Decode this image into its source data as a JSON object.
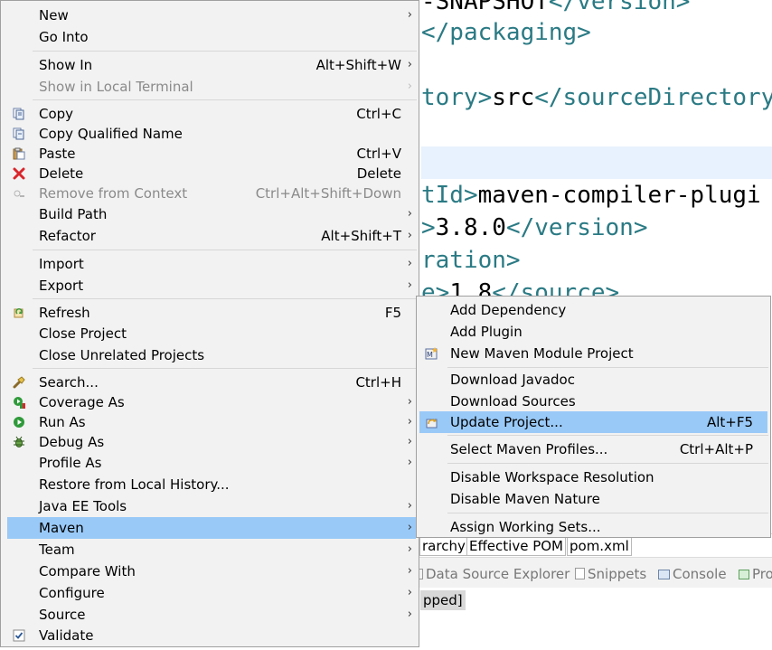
{
  "editor": {
    "lines": [
      {
        "tag_open": "",
        "text": "-SNAPSHOT",
        "tag_close": "</version>"
      },
      {
        "tag_open": "",
        "text": "",
        "tag_close": "</packaging>"
      },
      {
        "tag_open": "tory>",
        "text": "src",
        "tag_close": "</sourceDirectory"
      },
      {
        "tag_open": "tId>",
        "text": "maven-compiler-plugi",
        "tag_close": ""
      },
      {
        "tag_open": ">",
        "text": "3.8.0",
        "tag_close": "</version>"
      },
      {
        "tag_open": "ration>",
        "text": "",
        "tag_close": ""
      },
      {
        "tag_open": "e>",
        "text": "1.8",
        "tag_close": "</source>"
      }
    ]
  },
  "editor_tabs": [
    {
      "label": "rarchy"
    },
    {
      "label": "Effective POM"
    },
    {
      "label": "pom.xml"
    }
  ],
  "views": [
    {
      "label": "Data Source Explorer",
      "icon": "data-source-icon"
    },
    {
      "label": "Snippets",
      "icon": "snippets-icon"
    },
    {
      "label": "Console",
      "icon": "console-icon"
    },
    {
      "label": "Pro",
      "icon": "progress-icon"
    }
  ],
  "console": {
    "status": "pped]"
  },
  "context_menu": {
    "items": [
      {
        "label": "New",
        "shortcut": "",
        "submenu": true,
        "disabled": false
      },
      {
        "label": "Go Into",
        "shortcut": "",
        "submenu": false,
        "disabled": false
      },
      {
        "label": "Show In",
        "shortcut": "Alt+Shift+W",
        "submenu": true,
        "disabled": false
      },
      {
        "label": "Show in Local Terminal",
        "shortcut": "",
        "submenu": true,
        "disabled": true
      },
      {
        "label": "Copy",
        "shortcut": "Ctrl+C",
        "submenu": false,
        "disabled": false
      },
      {
        "label": "Copy Qualified Name",
        "shortcut": "",
        "submenu": false,
        "disabled": false
      },
      {
        "label": "Paste",
        "shortcut": "Ctrl+V",
        "submenu": false,
        "disabled": false
      },
      {
        "label": "Delete",
        "shortcut": "Delete",
        "submenu": false,
        "disabled": false
      },
      {
        "label": "Remove from Context",
        "shortcut": "Ctrl+Alt+Shift+Down",
        "submenu": false,
        "disabled": true
      },
      {
        "label": "Build Path",
        "shortcut": "",
        "submenu": true,
        "disabled": false
      },
      {
        "label": "Refactor",
        "shortcut": "Alt+Shift+T",
        "submenu": true,
        "disabled": false
      },
      {
        "label": "Import",
        "shortcut": "",
        "submenu": true,
        "disabled": false
      },
      {
        "label": "Export",
        "shortcut": "",
        "submenu": true,
        "disabled": false
      },
      {
        "label": "Refresh",
        "shortcut": "F5",
        "submenu": false,
        "disabled": false
      },
      {
        "label": "Close Project",
        "shortcut": "",
        "submenu": false,
        "disabled": false
      },
      {
        "label": "Close Unrelated Projects",
        "shortcut": "",
        "submenu": false,
        "disabled": false
      },
      {
        "label": "Search...",
        "shortcut": "Ctrl+H",
        "submenu": false,
        "disabled": false
      },
      {
        "label": "Coverage As",
        "shortcut": "",
        "submenu": true,
        "disabled": false
      },
      {
        "label": "Run As",
        "shortcut": "",
        "submenu": true,
        "disabled": false
      },
      {
        "label": "Debug As",
        "shortcut": "",
        "submenu": true,
        "disabled": false
      },
      {
        "label": "Profile As",
        "shortcut": "",
        "submenu": true,
        "disabled": false
      },
      {
        "label": "Restore from Local History...",
        "shortcut": "",
        "submenu": false,
        "disabled": false
      },
      {
        "label": "Java EE Tools",
        "shortcut": "",
        "submenu": true,
        "disabled": false
      },
      {
        "label": "Maven",
        "shortcut": "",
        "submenu": true,
        "disabled": false,
        "selected": true
      },
      {
        "label": "Team",
        "shortcut": "",
        "submenu": true,
        "disabled": false
      },
      {
        "label": "Compare With",
        "shortcut": "",
        "submenu": true,
        "disabled": false
      },
      {
        "label": "Configure",
        "shortcut": "",
        "submenu": true,
        "disabled": false
      },
      {
        "label": "Source",
        "shortcut": "",
        "submenu": true,
        "disabled": false
      },
      {
        "label": "Validate",
        "shortcut": "",
        "submenu": false,
        "disabled": false
      }
    ]
  },
  "maven_submenu": {
    "items": [
      {
        "label": "Add Dependency",
        "shortcut": ""
      },
      {
        "label": "Add Plugin",
        "shortcut": ""
      },
      {
        "label": "New Maven Module Project",
        "shortcut": ""
      },
      {
        "label": "Download Javadoc",
        "shortcut": ""
      },
      {
        "label": "Download Sources",
        "shortcut": ""
      },
      {
        "label": "Update Project...",
        "shortcut": "Alt+F5",
        "selected": true
      },
      {
        "label": "Select Maven Profiles...",
        "shortcut": "Ctrl+Alt+P"
      },
      {
        "label": "Disable Workspace Resolution",
        "shortcut": ""
      },
      {
        "label": "Disable Maven Nature",
        "shortcut": ""
      },
      {
        "label": "Assign Working Sets...",
        "shortcut": ""
      }
    ]
  },
  "colors": {
    "selection": "#99c9f7",
    "xml_tag": "#2a7a84",
    "menu_bg": "#f2f2f2",
    "disabled_text": "#8a8a8a"
  },
  "submenu_arrow": "›"
}
